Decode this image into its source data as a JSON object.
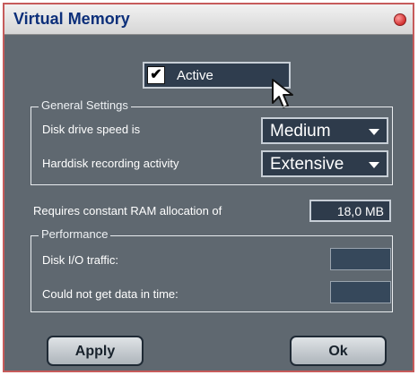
{
  "window": {
    "title": "Virtual Memory"
  },
  "active_toggle": {
    "label": "Active",
    "checked": true,
    "checkmark": "✔"
  },
  "general_settings": {
    "title": "General Settings",
    "disk_speed": {
      "label": "Disk drive speed is",
      "value": "Medium"
    },
    "recording_activity": {
      "label": "Harddisk recording activity",
      "value": "Extensive"
    }
  },
  "ram_allocation": {
    "label": "Requires constant RAM allocation of",
    "value": "18,0 MB"
  },
  "performance": {
    "title": "Performance",
    "disk_io": {
      "label": "Disk I/O traffic:",
      "value": ""
    },
    "data_timing": {
      "label": "Could not get data in time:",
      "value": ""
    }
  },
  "buttons": {
    "apply": "Apply",
    "ok": "Ok"
  },
  "colors": {
    "dialog_bg": "#5f6870",
    "field_bg": "#2e3b4b",
    "title_text": "#0c2f7a",
    "close": "#d23232"
  },
  "icons": [
    "close-icon",
    "checkbox-check-icon",
    "chevron-down-icon",
    "mouse-cursor-icon"
  ]
}
